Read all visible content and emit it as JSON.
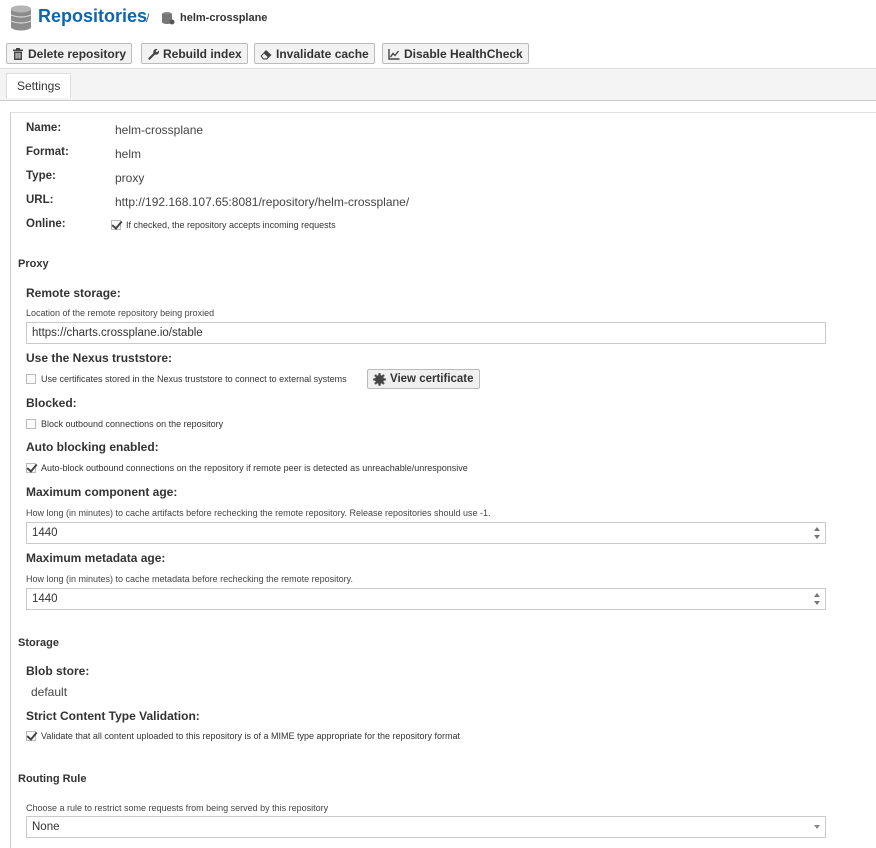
{
  "header": {
    "title": "Repositories",
    "separator": "/",
    "crumb": "helm-crossplane"
  },
  "toolbar": {
    "delete": "Delete repository",
    "rebuild": "Rebuild index",
    "invalidate": "Invalidate cache",
    "healthcheck": "Disable HealthCheck"
  },
  "tabs": {
    "settings": "Settings"
  },
  "summary": {
    "name_label": "Name:",
    "name": "helm-crossplane",
    "format_label": "Format:",
    "format": "helm",
    "type_label": "Type:",
    "type": "proxy",
    "url_label": "URL:",
    "url": "http://192.168.107.65:8081/repository/helm-crossplane/",
    "online_label": "Online:",
    "online_help": "If checked, the repository accepts incoming requests",
    "online": true
  },
  "proxy": {
    "section": "Proxy",
    "remote_label": "Remote storage:",
    "remote_help": "Location of the remote repository being proxied",
    "remote_value": "https://charts.crossplane.io/stable",
    "truststore_label": "Use the Nexus truststore:",
    "truststore_help": "Use certificates stored in the Nexus truststore to connect to external systems",
    "truststore": false,
    "view_cert": "View certificate",
    "blocked_label": "Blocked:",
    "blocked_help": "Block outbound connections on the repository",
    "blocked": false,
    "autoblock_label": "Auto blocking enabled:",
    "autoblock_help": "Auto-block outbound connections on the repository if remote peer is detected as unreachable/unresponsive",
    "autoblock": true,
    "max_comp_label": "Maximum component age:",
    "max_comp_help": "How long (in minutes) to cache artifacts before rechecking the remote repository. Release repositories should use -1.",
    "max_comp_value": "1440",
    "max_meta_label": "Maximum metadata age:",
    "max_meta_help": "How long (in minutes) to cache metadata before rechecking the remote repository.",
    "max_meta_value": "1440"
  },
  "storage": {
    "section": "Storage",
    "blob_label": "Blob store:",
    "blob_value": "default",
    "strict_label": "Strict Content Type Validation:",
    "strict_help": "Validate that all content uploaded to this repository is of a MIME type appropriate for the repository format",
    "strict": true
  },
  "routing": {
    "section": "Routing Rule",
    "help": "Choose a rule to restrict some requests from being served by this repository",
    "value": "None"
  },
  "colors": {
    "title": "#0c67ad",
    "border": "#c9c9c9"
  }
}
